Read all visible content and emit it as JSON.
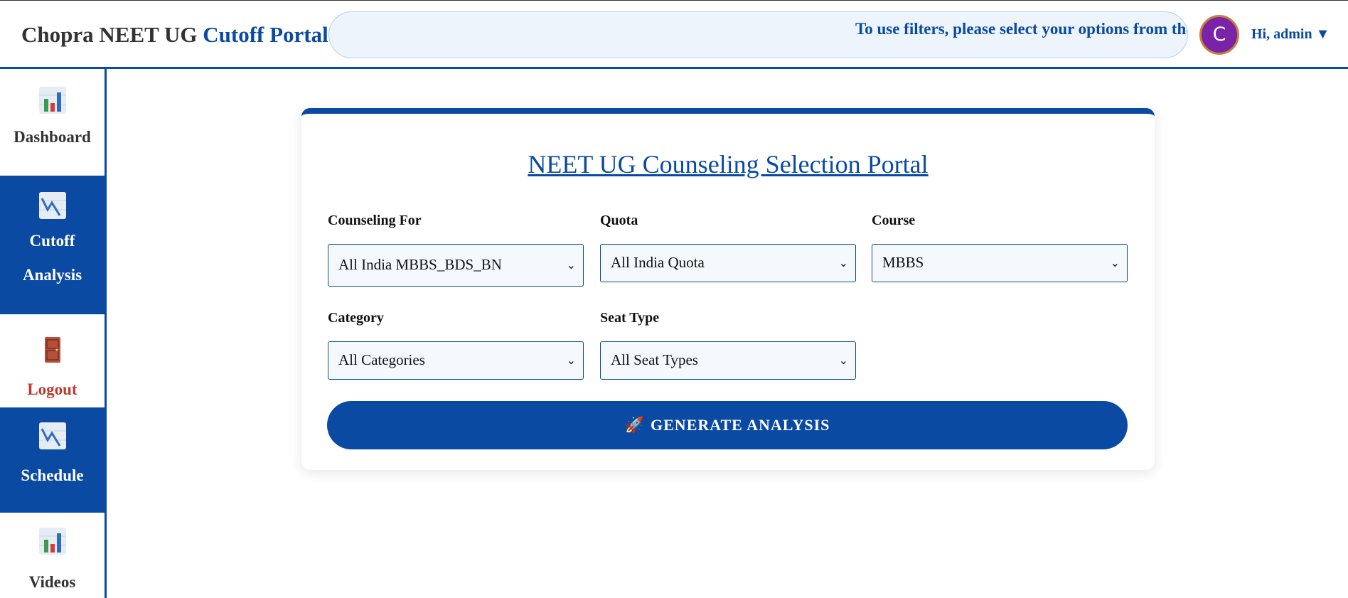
{
  "header": {
    "brand_primary": "Chopra NEET UG",
    "brand_accent": "Cutoff Portal",
    "ticker_text": "To use filters, please select your options from the dropdowns below",
    "avatar_letter": "C",
    "user_greeting": "Hi, admin ▼"
  },
  "sidebar": {
    "items": [
      {
        "label": "Dashboard",
        "icon": "bar-chart-icon",
        "active": false
      },
      {
        "label": "Cutoff Analysis",
        "icon": "line-chart-icon",
        "active": true
      },
      {
        "label": "Logout",
        "icon": "door-icon",
        "active": false
      },
      {
        "label": "Schedule",
        "icon": "line-chart-icon",
        "active": true
      },
      {
        "label": "Videos",
        "icon": "bar-chart-icon",
        "active": false
      }
    ]
  },
  "form": {
    "title": "NEET UG Counseling Selection Portal",
    "counseling_for": {
      "label": "Counseling For",
      "value": "All India MBBS_BDS_BN"
    },
    "quota": {
      "label": "Quota",
      "value": "All India Quota"
    },
    "course": {
      "label": "Course",
      "value": "MBBS"
    },
    "category": {
      "label": "Category",
      "value": "All Categories"
    },
    "seat_type": {
      "label": "Seat Type",
      "value": "All Seat Types"
    },
    "generate_label": "GENERATE ANALYSIS",
    "generate_icon": "🚀"
  },
  "colors": {
    "primary": "#0a4aa3",
    "logout": "#c0392b",
    "avatar": "#7a22a8"
  }
}
